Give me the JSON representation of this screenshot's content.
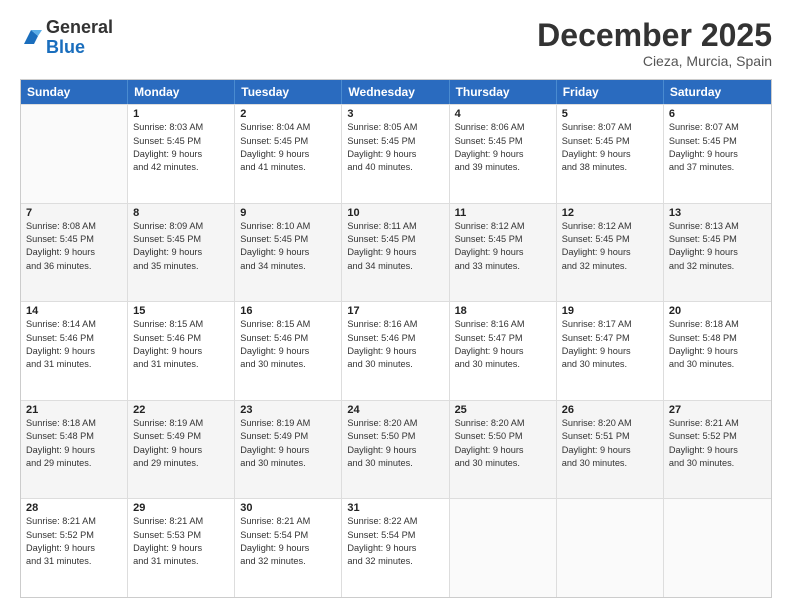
{
  "header": {
    "logo_general": "General",
    "logo_blue": "Blue",
    "month_title": "December 2025",
    "location": "Cieza, Murcia, Spain"
  },
  "weekdays": [
    "Sunday",
    "Monday",
    "Tuesday",
    "Wednesday",
    "Thursday",
    "Friday",
    "Saturday"
  ],
  "rows": [
    [
      {
        "day": "",
        "lines": [],
        "empty": true
      },
      {
        "day": "1",
        "lines": [
          "Sunrise: 8:03 AM",
          "Sunset: 5:45 PM",
          "Daylight: 9 hours",
          "and 42 minutes."
        ]
      },
      {
        "day": "2",
        "lines": [
          "Sunrise: 8:04 AM",
          "Sunset: 5:45 PM",
          "Daylight: 9 hours",
          "and 41 minutes."
        ]
      },
      {
        "day": "3",
        "lines": [
          "Sunrise: 8:05 AM",
          "Sunset: 5:45 PM",
          "Daylight: 9 hours",
          "and 40 minutes."
        ]
      },
      {
        "day": "4",
        "lines": [
          "Sunrise: 8:06 AM",
          "Sunset: 5:45 PM",
          "Daylight: 9 hours",
          "and 39 minutes."
        ]
      },
      {
        "day": "5",
        "lines": [
          "Sunrise: 8:07 AM",
          "Sunset: 5:45 PM",
          "Daylight: 9 hours",
          "and 38 minutes."
        ]
      },
      {
        "day": "6",
        "lines": [
          "Sunrise: 8:07 AM",
          "Sunset: 5:45 PM",
          "Daylight: 9 hours",
          "and 37 minutes."
        ]
      }
    ],
    [
      {
        "day": "7",
        "lines": [
          "Sunrise: 8:08 AM",
          "Sunset: 5:45 PM",
          "Daylight: 9 hours",
          "and 36 minutes."
        ],
        "shaded": true
      },
      {
        "day": "8",
        "lines": [
          "Sunrise: 8:09 AM",
          "Sunset: 5:45 PM",
          "Daylight: 9 hours",
          "and 35 minutes."
        ],
        "shaded": true
      },
      {
        "day": "9",
        "lines": [
          "Sunrise: 8:10 AM",
          "Sunset: 5:45 PM",
          "Daylight: 9 hours",
          "and 34 minutes."
        ],
        "shaded": true
      },
      {
        "day": "10",
        "lines": [
          "Sunrise: 8:11 AM",
          "Sunset: 5:45 PM",
          "Daylight: 9 hours",
          "and 34 minutes."
        ],
        "shaded": true
      },
      {
        "day": "11",
        "lines": [
          "Sunrise: 8:12 AM",
          "Sunset: 5:45 PM",
          "Daylight: 9 hours",
          "and 33 minutes."
        ],
        "shaded": true
      },
      {
        "day": "12",
        "lines": [
          "Sunrise: 8:12 AM",
          "Sunset: 5:45 PM",
          "Daylight: 9 hours",
          "and 32 minutes."
        ],
        "shaded": true
      },
      {
        "day": "13",
        "lines": [
          "Sunrise: 8:13 AM",
          "Sunset: 5:45 PM",
          "Daylight: 9 hours",
          "and 32 minutes."
        ],
        "shaded": true
      }
    ],
    [
      {
        "day": "14",
        "lines": [
          "Sunrise: 8:14 AM",
          "Sunset: 5:46 PM",
          "Daylight: 9 hours",
          "and 31 minutes."
        ]
      },
      {
        "day": "15",
        "lines": [
          "Sunrise: 8:15 AM",
          "Sunset: 5:46 PM",
          "Daylight: 9 hours",
          "and 31 minutes."
        ]
      },
      {
        "day": "16",
        "lines": [
          "Sunrise: 8:15 AM",
          "Sunset: 5:46 PM",
          "Daylight: 9 hours",
          "and 30 minutes."
        ]
      },
      {
        "day": "17",
        "lines": [
          "Sunrise: 8:16 AM",
          "Sunset: 5:46 PM",
          "Daylight: 9 hours",
          "and 30 minutes."
        ]
      },
      {
        "day": "18",
        "lines": [
          "Sunrise: 8:16 AM",
          "Sunset: 5:47 PM",
          "Daylight: 9 hours",
          "and 30 minutes."
        ]
      },
      {
        "day": "19",
        "lines": [
          "Sunrise: 8:17 AM",
          "Sunset: 5:47 PM",
          "Daylight: 9 hours",
          "and 30 minutes."
        ]
      },
      {
        "day": "20",
        "lines": [
          "Sunrise: 8:18 AM",
          "Sunset: 5:48 PM",
          "Daylight: 9 hours",
          "and 30 minutes."
        ]
      }
    ],
    [
      {
        "day": "21",
        "lines": [
          "Sunrise: 8:18 AM",
          "Sunset: 5:48 PM",
          "Daylight: 9 hours",
          "and 29 minutes."
        ],
        "shaded": true
      },
      {
        "day": "22",
        "lines": [
          "Sunrise: 8:19 AM",
          "Sunset: 5:49 PM",
          "Daylight: 9 hours",
          "and 29 minutes."
        ],
        "shaded": true
      },
      {
        "day": "23",
        "lines": [
          "Sunrise: 8:19 AM",
          "Sunset: 5:49 PM",
          "Daylight: 9 hours",
          "and 30 minutes."
        ],
        "shaded": true
      },
      {
        "day": "24",
        "lines": [
          "Sunrise: 8:20 AM",
          "Sunset: 5:50 PM",
          "Daylight: 9 hours",
          "and 30 minutes."
        ],
        "shaded": true
      },
      {
        "day": "25",
        "lines": [
          "Sunrise: 8:20 AM",
          "Sunset: 5:50 PM",
          "Daylight: 9 hours",
          "and 30 minutes."
        ],
        "shaded": true
      },
      {
        "day": "26",
        "lines": [
          "Sunrise: 8:20 AM",
          "Sunset: 5:51 PM",
          "Daylight: 9 hours",
          "and 30 minutes."
        ],
        "shaded": true
      },
      {
        "day": "27",
        "lines": [
          "Sunrise: 8:21 AM",
          "Sunset: 5:52 PM",
          "Daylight: 9 hours",
          "and 30 minutes."
        ],
        "shaded": true
      }
    ],
    [
      {
        "day": "28",
        "lines": [
          "Sunrise: 8:21 AM",
          "Sunset: 5:52 PM",
          "Daylight: 9 hours",
          "and 31 minutes."
        ]
      },
      {
        "day": "29",
        "lines": [
          "Sunrise: 8:21 AM",
          "Sunset: 5:53 PM",
          "Daylight: 9 hours",
          "and 31 minutes."
        ]
      },
      {
        "day": "30",
        "lines": [
          "Sunrise: 8:21 AM",
          "Sunset: 5:54 PM",
          "Daylight: 9 hours",
          "and 32 minutes."
        ]
      },
      {
        "day": "31",
        "lines": [
          "Sunrise: 8:22 AM",
          "Sunset: 5:54 PM",
          "Daylight: 9 hours",
          "and 32 minutes."
        ]
      },
      {
        "day": "",
        "lines": [],
        "empty": true
      },
      {
        "day": "",
        "lines": [],
        "empty": true
      },
      {
        "day": "",
        "lines": [],
        "empty": true
      }
    ]
  ]
}
